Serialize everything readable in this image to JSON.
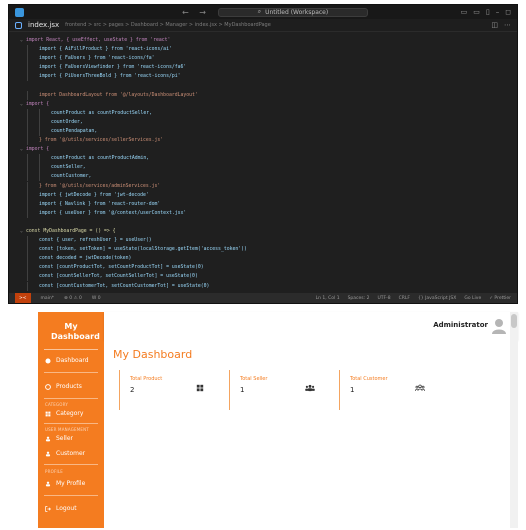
{
  "editor": {
    "search_text": "Untitled (Workspace)",
    "tab": {
      "file_name": "index.jsx",
      "path": "frontend > src > pages > Dashboard > Manager > index.jsx > MyDashboardPage"
    },
    "code": {
      "l1": "import React, { useEffect, useState } from 'react'",
      "l2": "import { AiFillProduct } from 'react-icons/ai'",
      "l3": "import { FaUsers } from 'react-icons/fa'",
      "l4": "import { FaUsersViewfinder } from 'react-icons/fa6'",
      "l5": "import { PiUsersThreeBold } from 'react-icons/pi'",
      "l6": "import DashboardLayout from '@/layouts/DashboardLayout'",
      "l7": "import {",
      "l8": "countProduct as countProductSeller,",
      "l9": "countOrder,",
      "l10": "countPendapatan,",
      "l11": "} from '@/utils/services/sellerServices.js'",
      "l12": "import {",
      "l13": "countProduct as countProductAdmin,",
      "l14": "countSeller,",
      "l15": "countCustomer,",
      "l16": "} from '@/utils/services/adminServices.js'",
      "l17": "import { jwtDecode } from 'jwt-decode'",
      "l18": "import { Navlink } from 'react-router-dom'",
      "l19": "import { useUser } from '@/context/userContext.jsx'",
      "l20": "const MyDashboardPage = () => {",
      "l21": "const { user, refreshUser } = useUser()",
      "l22": "const [token, setToken] = useState(localStorage.getItem('access_token'))",
      "l23": "const decoded = jwtDecode(token)",
      "l24": "const [countProductTot, setCountProductTot] = useState(0)",
      "l25": "const [countSellerTot, setCountSellerTot] = useState(0)",
      "l26": "const [countCustomerTot, setCountCustomerTot] = useState(0)"
    },
    "status": {
      "remote": "><",
      "branch": "main*",
      "problems": "⊗ 0 ⚠ 0",
      "ports": "W 0",
      "position": "Ln 1, Col 1",
      "spaces": "Spaces: 2",
      "encoding": "UTF-8",
      "eol": "CRLF",
      "language": "{} JavaScript JSX",
      "golive": "Go Live",
      "prettier": "✓ Prettier"
    }
  },
  "app": {
    "brand": "My Dashboard",
    "sidebar": {
      "dashboard": "Dashboard",
      "products": "Products",
      "section_category": "CATEGORY",
      "category": "Category",
      "section_users": "USER MANAGEMENT",
      "seller": "Seller",
      "customer": "Customer",
      "section_profile": "PROFILE",
      "my_profile": "My Profile",
      "logout": "Logout"
    },
    "topbar": {
      "admin_name": "Administrator"
    },
    "page_title": "My Dashboard",
    "cards": [
      {
        "label": "Total Product",
        "value": "2",
        "icon": "product-grid-icon"
      },
      {
        "label": "Total Seller",
        "value": "1",
        "icon": "users-icon"
      },
      {
        "label": "Total Customer",
        "value": "1",
        "icon": "users-three-icon"
      }
    ],
    "colors": {
      "accent": "#f47c20",
      "editor_bg": "#1f1f1f"
    }
  }
}
